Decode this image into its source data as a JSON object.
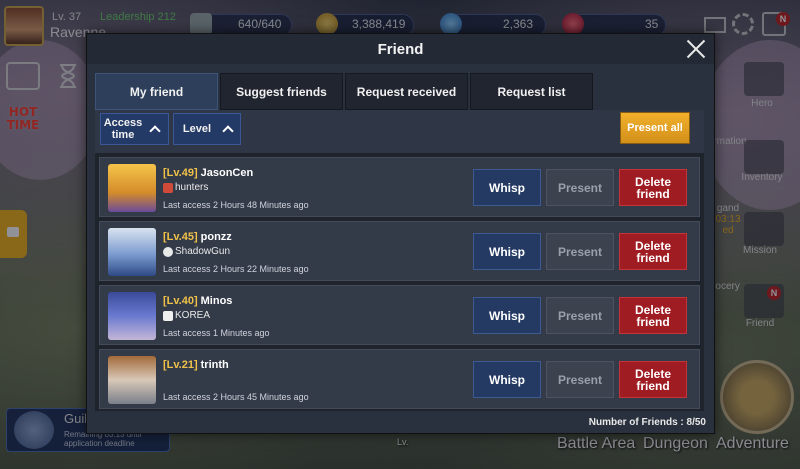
{
  "hud": {
    "level": "Lv. 37",
    "player_name": "Ravenne",
    "leadership": "Leadership 212",
    "stamina": "640/640",
    "gold": "3,388,419",
    "gems": "2,363",
    "hearts": "35",
    "notice_badge": "N"
  },
  "side": {
    "hot_time": [
      "HOT",
      "TIME"
    ],
    "guild_name": "Guil",
    "guild_sub": "Remaining 03:13 until application deadline"
  },
  "right_menu": {
    "hero": "Hero",
    "formation": "rmation",
    "inventory": "Inventory",
    "legend": "gand",
    "timer": "03:13",
    "timer_b": "ed",
    "mission": "Mission",
    "grocery": "rocery",
    "friend": "Friend",
    "friend_badge": "N"
  },
  "bottom": {
    "battle_area": "Battle Area",
    "dungeon": "Dungeon",
    "adventure": "Adventure",
    "lv_fragment": "Lv."
  },
  "dialog": {
    "title": "Friend",
    "tabs": [
      "My friend",
      "Suggest friends",
      "Request received",
      "Request list"
    ],
    "sort_access": "Access time",
    "sort_level": "Level",
    "present_all": "Present all",
    "whisp": "Whisp",
    "present": "Present",
    "delete": "Delete friend",
    "count": "Number of Friends : 8/50",
    "friends": [
      {
        "level": "[Lv.49]",
        "name": "JasonCen",
        "guild": "hunters",
        "last": "Last access 2 Hours 48 Minutes ago"
      },
      {
        "level": "[Lv.45]",
        "name": "ponzz",
        "guild": "ShadowGun",
        "last": "Last access 2 Hours 22 Minutes ago"
      },
      {
        "level": "[Lv.40]",
        "name": "Minos",
        "guild": "KOREA",
        "last": "Last access 1 Minutes ago"
      },
      {
        "level": "[Lv.21]",
        "name": "trinth",
        "guild": "",
        "last": "Last access 2 Hours 45 Minutes ago"
      }
    ]
  }
}
